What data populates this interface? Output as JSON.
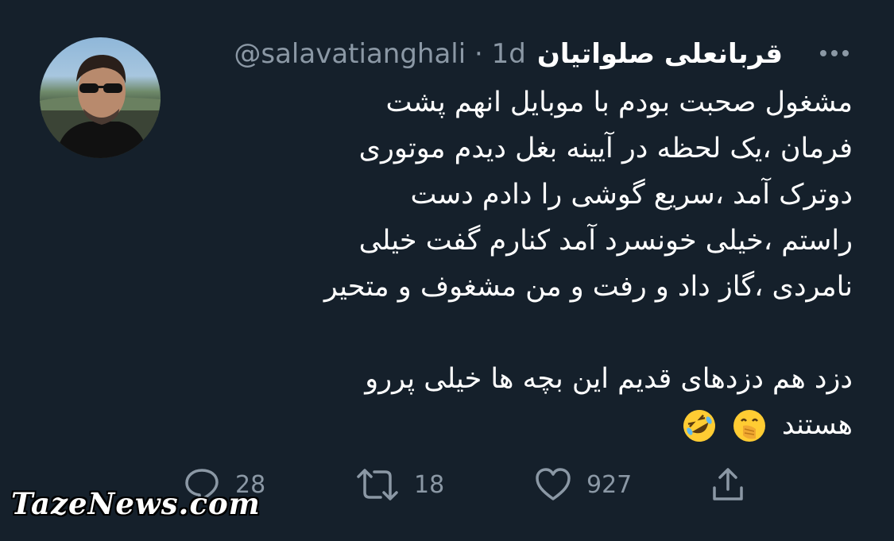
{
  "tweet": {
    "display_name": "قربانعلی صلواتیان",
    "handle": "@salavatianghali",
    "separator": "·",
    "time": "1d",
    "lines": [
      "مشغول صحبت بودم با موبایل انهم پشت",
      "فرمان ،یک لحظه در آیینه بغل دیدم موتوری",
      "دوترک آمد ،سریع گوشی را دادم دست",
      "راستم ،خیلی خونسرد آمد کنارم گفت خیلی",
      "نامردی ،گاز داد و رفت و من مشغوف و متحیر",
      "",
      "دزد هم دزدهای قدیم این بچه ها خیلی پررو",
      "هستند"
    ],
    "emojis": [
      "face-with-hand-over-mouth-emoji",
      "rolling-on-floor-laughing-emoji"
    ]
  },
  "actions": {
    "replies": "28",
    "retweets": "18",
    "likes": "927"
  },
  "icons": {
    "more": "more-icon",
    "reply": "reply-icon",
    "retweet": "retweet-icon",
    "like": "heart-icon",
    "share": "share-icon"
  },
  "watermark": "TazeNews.com",
  "colors": {
    "background": "#15202b",
    "text": "#ffffff",
    "secondary": "#8b98a5"
  }
}
